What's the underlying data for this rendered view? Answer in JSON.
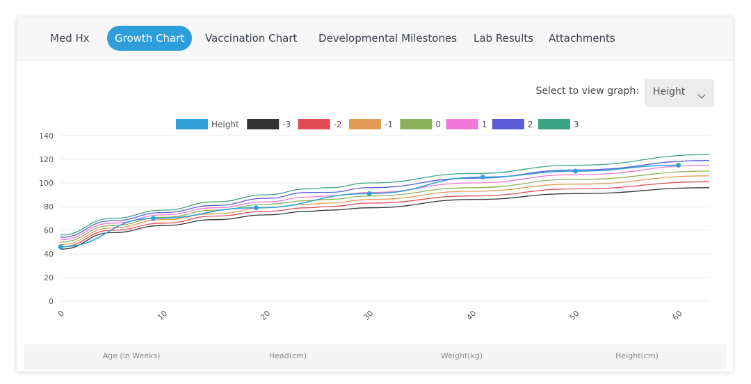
{
  "tabs": [
    {
      "label": "Med Hx"
    },
    {
      "label": "Growth Chart"
    },
    {
      "label": "Vaccination Chart"
    },
    {
      "label": "Developmental Milestones"
    },
    {
      "label": "Lab Results"
    },
    {
      "label": "Attachments"
    }
  ],
  "active_tab": "Growth Chart",
  "selector": {
    "label": "Select to view graph:",
    "value": "Height"
  },
  "table_header": {
    "columns": [
      "Age (in Weeks)",
      "Head(cm)",
      "Weight(kg)",
      "Height(cm)"
    ]
  },
  "colors": {
    "accent": "#2e9ddb",
    "height": "#2f9fd6",
    "-3": "#333333",
    "-2": "#e04b57",
    "-1": "#e39a52",
    "0": "#8db05a",
    "1": "#ee76d6",
    "2": "#5b5bd6",
    "3": "#3aa384"
  },
  "chart_data": {
    "type": "line",
    "xlabel": "",
    "ylabel": "",
    "xlim": [
      0,
      63
    ],
    "ylim": [
      0,
      140
    ],
    "x_ticks": [
      0,
      10,
      20,
      30,
      40,
      50,
      60
    ],
    "y_ticks": [
      0,
      20,
      40,
      60,
      80,
      100,
      120,
      140
    ],
    "legend_position": "top",
    "grid": true,
    "series": [
      {
        "name": "Height",
        "color": "#2f9fd6",
        "markers": true,
        "points": [
          [
            0,
            46
          ],
          [
            9,
            70
          ],
          [
            19,
            79
          ],
          [
            30,
            91
          ],
          [
            41,
            105
          ],
          [
            50,
            110
          ],
          [
            60,
            115
          ]
        ]
      },
      {
        "name": "-3",
        "color": "#333333",
        "points": [
          [
            0,
            44
          ],
          [
            5,
            58
          ],
          [
            10,
            64
          ],
          [
            15,
            69
          ],
          [
            20,
            73
          ],
          [
            24,
            76
          ],
          [
            26,
            77
          ],
          [
            30,
            79
          ],
          [
            40,
            86
          ],
          [
            50,
            91
          ],
          [
            63,
            96
          ]
        ]
      },
      {
        "name": "-2",
        "color": "#e04b57",
        "points": [
          [
            0,
            46
          ],
          [
            5,
            60
          ],
          [
            10,
            66
          ],
          [
            15,
            72
          ],
          [
            20,
            76
          ],
          [
            24,
            79
          ],
          [
            26,
            80
          ],
          [
            30,
            83
          ],
          [
            40,
            89
          ],
          [
            50,
            95
          ],
          [
            63,
            101
          ]
        ]
      },
      {
        "name": "-1",
        "color": "#e39a52",
        "points": [
          [
            0,
            48
          ],
          [
            5,
            62
          ],
          [
            10,
            69
          ],
          [
            15,
            74
          ],
          [
            20,
            79
          ],
          [
            24,
            82
          ],
          [
            26,
            83
          ],
          [
            30,
            86
          ],
          [
            40,
            93
          ],
          [
            50,
            99
          ],
          [
            63,
            106
          ]
        ]
      },
      {
        "name": "0",
        "color": "#8db05a",
        "points": [
          [
            0,
            50
          ],
          [
            5,
            64
          ],
          [
            10,
            71
          ],
          [
            15,
            77
          ],
          [
            20,
            82
          ],
          [
            24,
            85
          ],
          [
            26,
            86
          ],
          [
            30,
            89
          ],
          [
            40,
            96
          ],
          [
            50,
            103
          ],
          [
            63,
            110
          ]
        ]
      },
      {
        "name": "1",
        "color": "#ee76d6",
        "points": [
          [
            0,
            52
          ],
          [
            5,
            66
          ],
          [
            10,
            73
          ],
          [
            15,
            79
          ],
          [
            20,
            84
          ],
          [
            24,
            88
          ],
          [
            26,
            89
          ],
          [
            30,
            92
          ],
          [
            40,
            100
          ],
          [
            50,
            107
          ],
          [
            63,
            115
          ]
        ]
      },
      {
        "name": "2",
        "color": "#5b5bd6",
        "points": [
          [
            0,
            54
          ],
          [
            5,
            68
          ],
          [
            10,
            75
          ],
          [
            15,
            81
          ],
          [
            20,
            87
          ],
          [
            24,
            92
          ],
          [
            26,
            92
          ],
          [
            30,
            96
          ],
          [
            40,
            104
          ],
          [
            50,
            111
          ],
          [
            63,
            119
          ]
        ]
      },
      {
        "name": "3",
        "color": "#3aa384",
        "points": [
          [
            0,
            56
          ],
          [
            5,
            70
          ],
          [
            10,
            77
          ],
          [
            15,
            84
          ],
          [
            20,
            90
          ],
          [
            24,
            95
          ],
          [
            26,
            96
          ],
          [
            30,
            100
          ],
          [
            40,
            108
          ],
          [
            50,
            115
          ],
          [
            63,
            124
          ]
        ]
      }
    ]
  }
}
